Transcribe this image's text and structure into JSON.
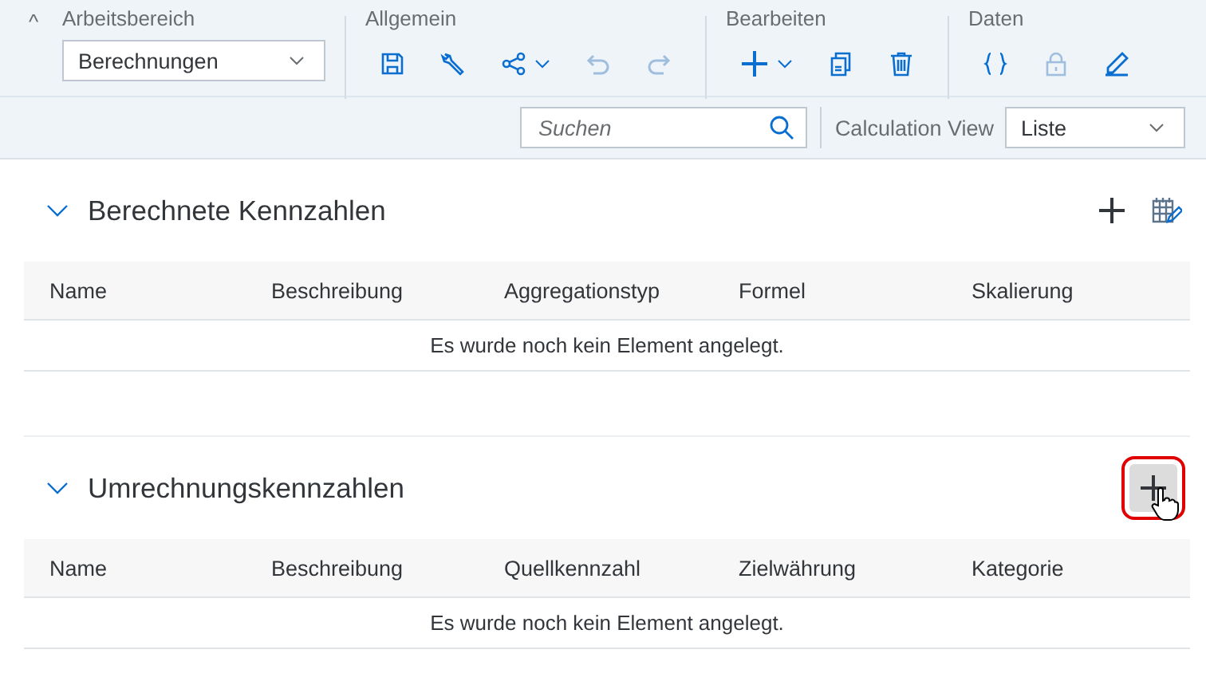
{
  "toolbar": {
    "collapse_icon": "^",
    "workspace": {
      "label": "Arbeitsbereich",
      "value": "Berechnungen"
    },
    "groups": [
      {
        "label": "Allgemein",
        "tools": [
          {
            "kind": "save",
            "disabled": false,
            "menu": false
          },
          {
            "kind": "wrench",
            "disabled": false,
            "menu": false
          },
          {
            "kind": "share",
            "disabled": false,
            "menu": true
          },
          {
            "kind": "undo",
            "disabled": true,
            "menu": false
          },
          {
            "kind": "redo",
            "disabled": true,
            "menu": false
          }
        ]
      },
      {
        "label": "Bearbeiten",
        "tools": [
          {
            "kind": "add",
            "disabled": false,
            "menu": true
          },
          {
            "kind": "copy",
            "disabled": false,
            "menu": false
          },
          {
            "kind": "delete",
            "disabled": false,
            "menu": false
          }
        ]
      },
      {
        "label": "Daten",
        "tools": [
          {
            "kind": "braces",
            "disabled": false,
            "menu": false
          },
          {
            "kind": "lock",
            "disabled": true,
            "menu": false
          },
          {
            "kind": "pen",
            "disabled": false,
            "menu": false
          }
        ]
      }
    ]
  },
  "filter_bar": {
    "search": {
      "placeholder": "Suchen"
    },
    "view_label": "Calculation View",
    "view_value": "Liste"
  },
  "sections": [
    {
      "title": "Berechnete Kennzahlen",
      "expanded": true,
      "add_highlighted": false,
      "table_edit": true,
      "columns": [
        "Name",
        "Beschreibung",
        "Aggregationstyp",
        "Formel",
        "Skalierung"
      ],
      "empty_text": "Es wurde noch kein Element angelegt."
    },
    {
      "title": "Umrechnungskennzahlen",
      "expanded": true,
      "add_highlighted": true,
      "table_edit": false,
      "columns": [
        "Name",
        "Beschreibung",
        "Quellkennzahl",
        "Zielwährung",
        "Kategorie"
      ],
      "empty_text": "Es wurde noch kein Element angelegt."
    }
  ]
}
